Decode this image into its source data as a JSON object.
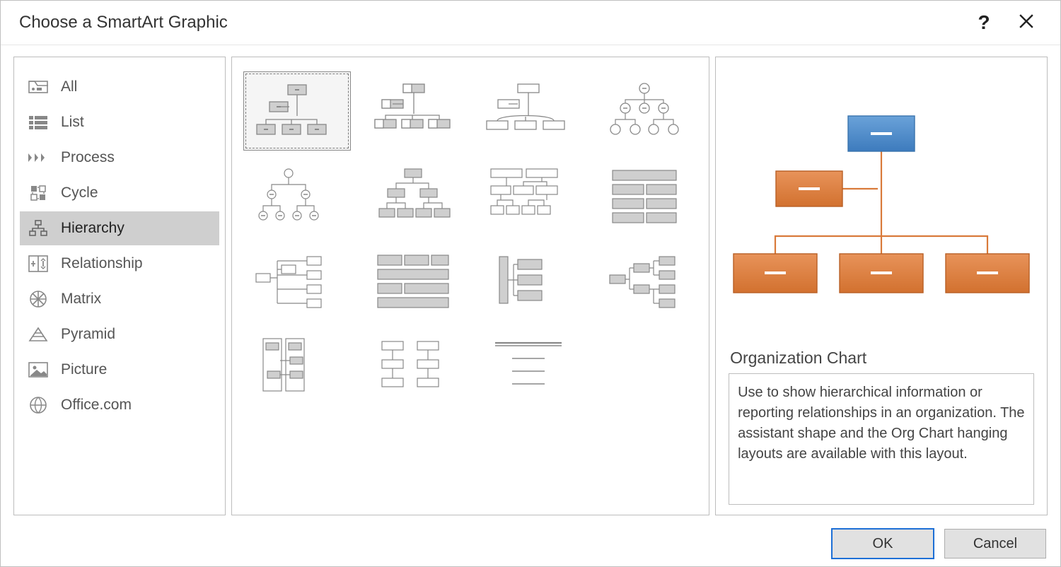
{
  "dialog": {
    "title": "Choose a SmartArt Graphic",
    "help_tooltip": "Help",
    "close_tooltip": "Close"
  },
  "sidebar": {
    "items": [
      {
        "id": "all",
        "label": "All"
      },
      {
        "id": "list",
        "label": "List"
      },
      {
        "id": "process",
        "label": "Process"
      },
      {
        "id": "cycle",
        "label": "Cycle"
      },
      {
        "id": "hierarchy",
        "label": "Hierarchy",
        "selected": true
      },
      {
        "id": "relationship",
        "label": "Relationship"
      },
      {
        "id": "matrix",
        "label": "Matrix"
      },
      {
        "id": "pyramid",
        "label": "Pyramid"
      },
      {
        "id": "picture",
        "label": "Picture"
      },
      {
        "id": "officecom",
        "label": "Office.com"
      }
    ]
  },
  "gallery": {
    "selected_index": 0,
    "items": [
      "organization-chart",
      "name-and-title-organization-chart",
      "half-circle-organization-chart",
      "circle-picture-hierarchy",
      "hierarchy",
      "labeled-hierarchy",
      "table-hierarchy",
      "hierarchy-list",
      "horizontal-organization-chart",
      "horizontal-multi-level-hierarchy",
      "horizontal-hierarchy",
      "horizontal-labeled-hierarchy",
      "lined-list",
      "architecture-layout",
      "simple-lined-list"
    ]
  },
  "preview": {
    "name": "Organization Chart",
    "description": "Use to show hierarchical information or reporting relationships in an organization. The assistant shape and the Org Chart hanging layouts are available with this layout.",
    "colors": {
      "top": "#4a89c8",
      "top_border": "#3b74ad",
      "node": "#d97a3a",
      "node_border": "#b85f25",
      "line": "#d97a3a"
    }
  },
  "buttons": {
    "ok": "OK",
    "cancel": "Cancel"
  }
}
